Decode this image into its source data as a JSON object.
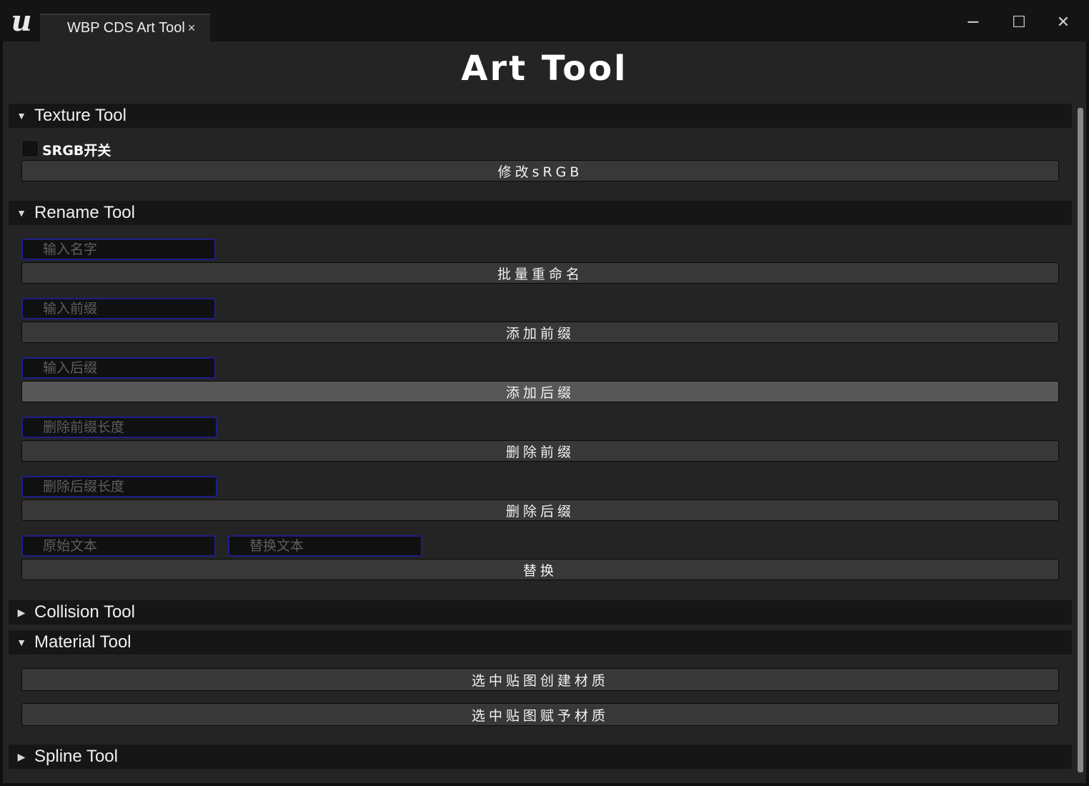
{
  "window": {
    "tab_title": "WBP CDS Art Tool",
    "tab_close": "×",
    "minimize": "─",
    "maximize": "☐",
    "close": "✕",
    "logo": "u"
  },
  "app": {
    "title": "Art Tool"
  },
  "sections": {
    "texture": {
      "title": "Texture Tool",
      "expanded": true,
      "srgb_label": "SRGB开关",
      "srgb_checked": false,
      "modify_srgb": "修改sRGB"
    },
    "rename": {
      "title": "Rename Tool",
      "expanded": true,
      "name_placeholder": "输入名字",
      "batch_rename": "批量重命名",
      "prefix_placeholder": "输入前缀",
      "add_prefix": "添加前缀",
      "suffix_placeholder": "输入后缀",
      "add_suffix": "添加后缀",
      "remove_prefix_len_placeholder": "删除前缀长度",
      "remove_prefix": "删除前缀",
      "remove_suffix_len_placeholder": "删除后缀长度",
      "remove_suffix": "删除后缀",
      "original_text_placeholder": "原始文本",
      "replace_text_placeholder": "替换文本",
      "replace": "替换"
    },
    "collision": {
      "title": "Collision Tool",
      "expanded": false
    },
    "material": {
      "title": "Material Tool",
      "expanded": true,
      "create_material": "选中贴图创建材质",
      "assign_material": "选中贴图赋予材质"
    },
    "spline": {
      "title": "Spline Tool",
      "expanded": false
    }
  },
  "icons": {
    "expanded": "▼",
    "collapsed": "▶"
  },
  "colors": {
    "panel_bg": "#242424",
    "section_bg": "#161616",
    "button_bg": "#383838",
    "button_hover_bg": "#575757",
    "input_border": "#1e1e8a"
  }
}
